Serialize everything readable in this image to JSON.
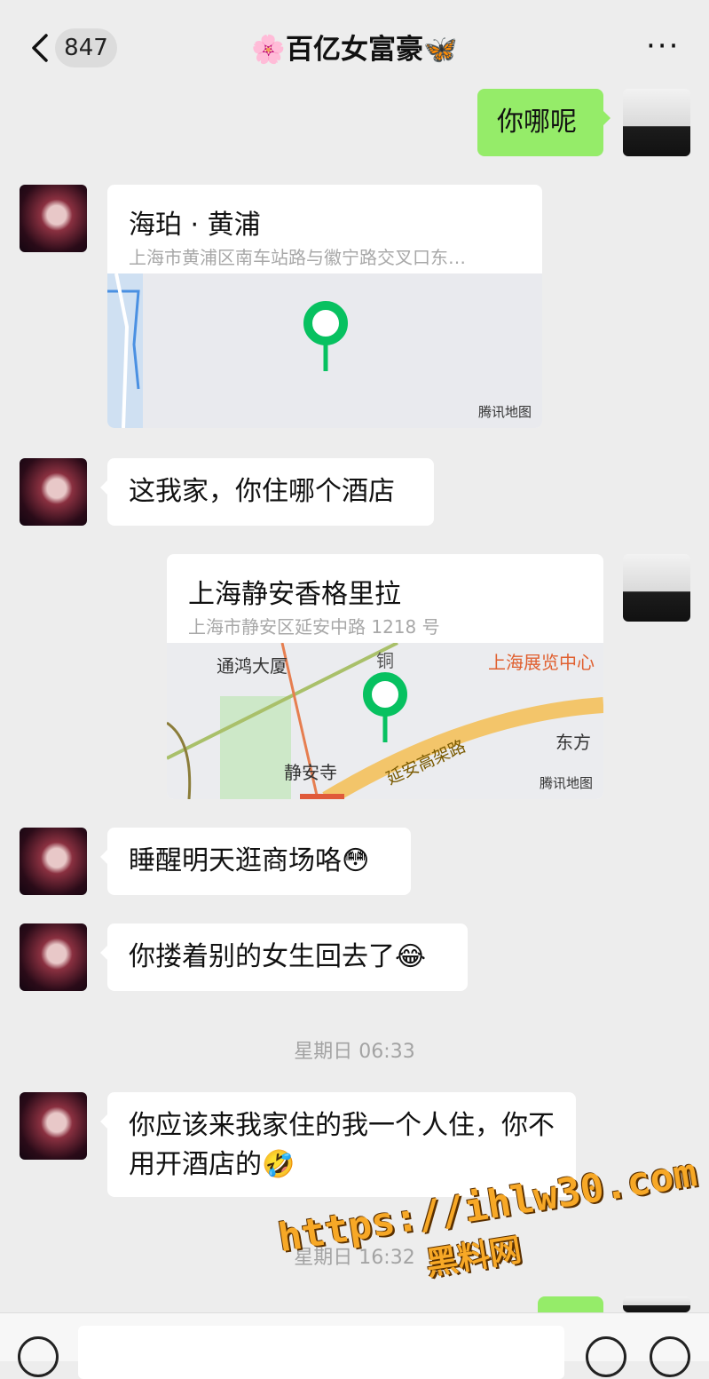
{
  "header": {
    "unread_count": "847",
    "title": "🌸百亿女富豪🦋",
    "more_label": "···"
  },
  "messages": [
    {
      "text": "你哪呢"
    },
    {
      "name": "海珀 · 黄浦",
      "address": "上海市黄浦区南车站路与徽宁路交叉口东…",
      "map_brand": "腾讯地图"
    },
    {
      "text": "这我家，你住哪个酒店"
    },
    {
      "name": "上海静安香格里拉",
      "address": "上海市静安区延安中路 1218 号",
      "map_brand": "腾讯地图",
      "map_labels": [
        "通鸿大厦",
        "上海展览中心",
        "东方",
        "静安寺",
        "延安高架路",
        "铜"
      ]
    },
    {
      "text": "睡醒明天逛商场咯😳"
    },
    {
      "text": "你搂着别的女生回去了😂"
    },
    {
      "text": "你应该来我家住的我一个人住，你不用开酒店的🤣"
    }
  ],
  "timestamps": [
    "星期日 06:33",
    "星期日 16:32"
  ],
  "watermark": {
    "url": "https://ihlw30.com",
    "site": "黑料网"
  },
  "colors": {
    "self_bubble": "#95ec69",
    "pin": "#07c160",
    "background": "#ededed"
  }
}
